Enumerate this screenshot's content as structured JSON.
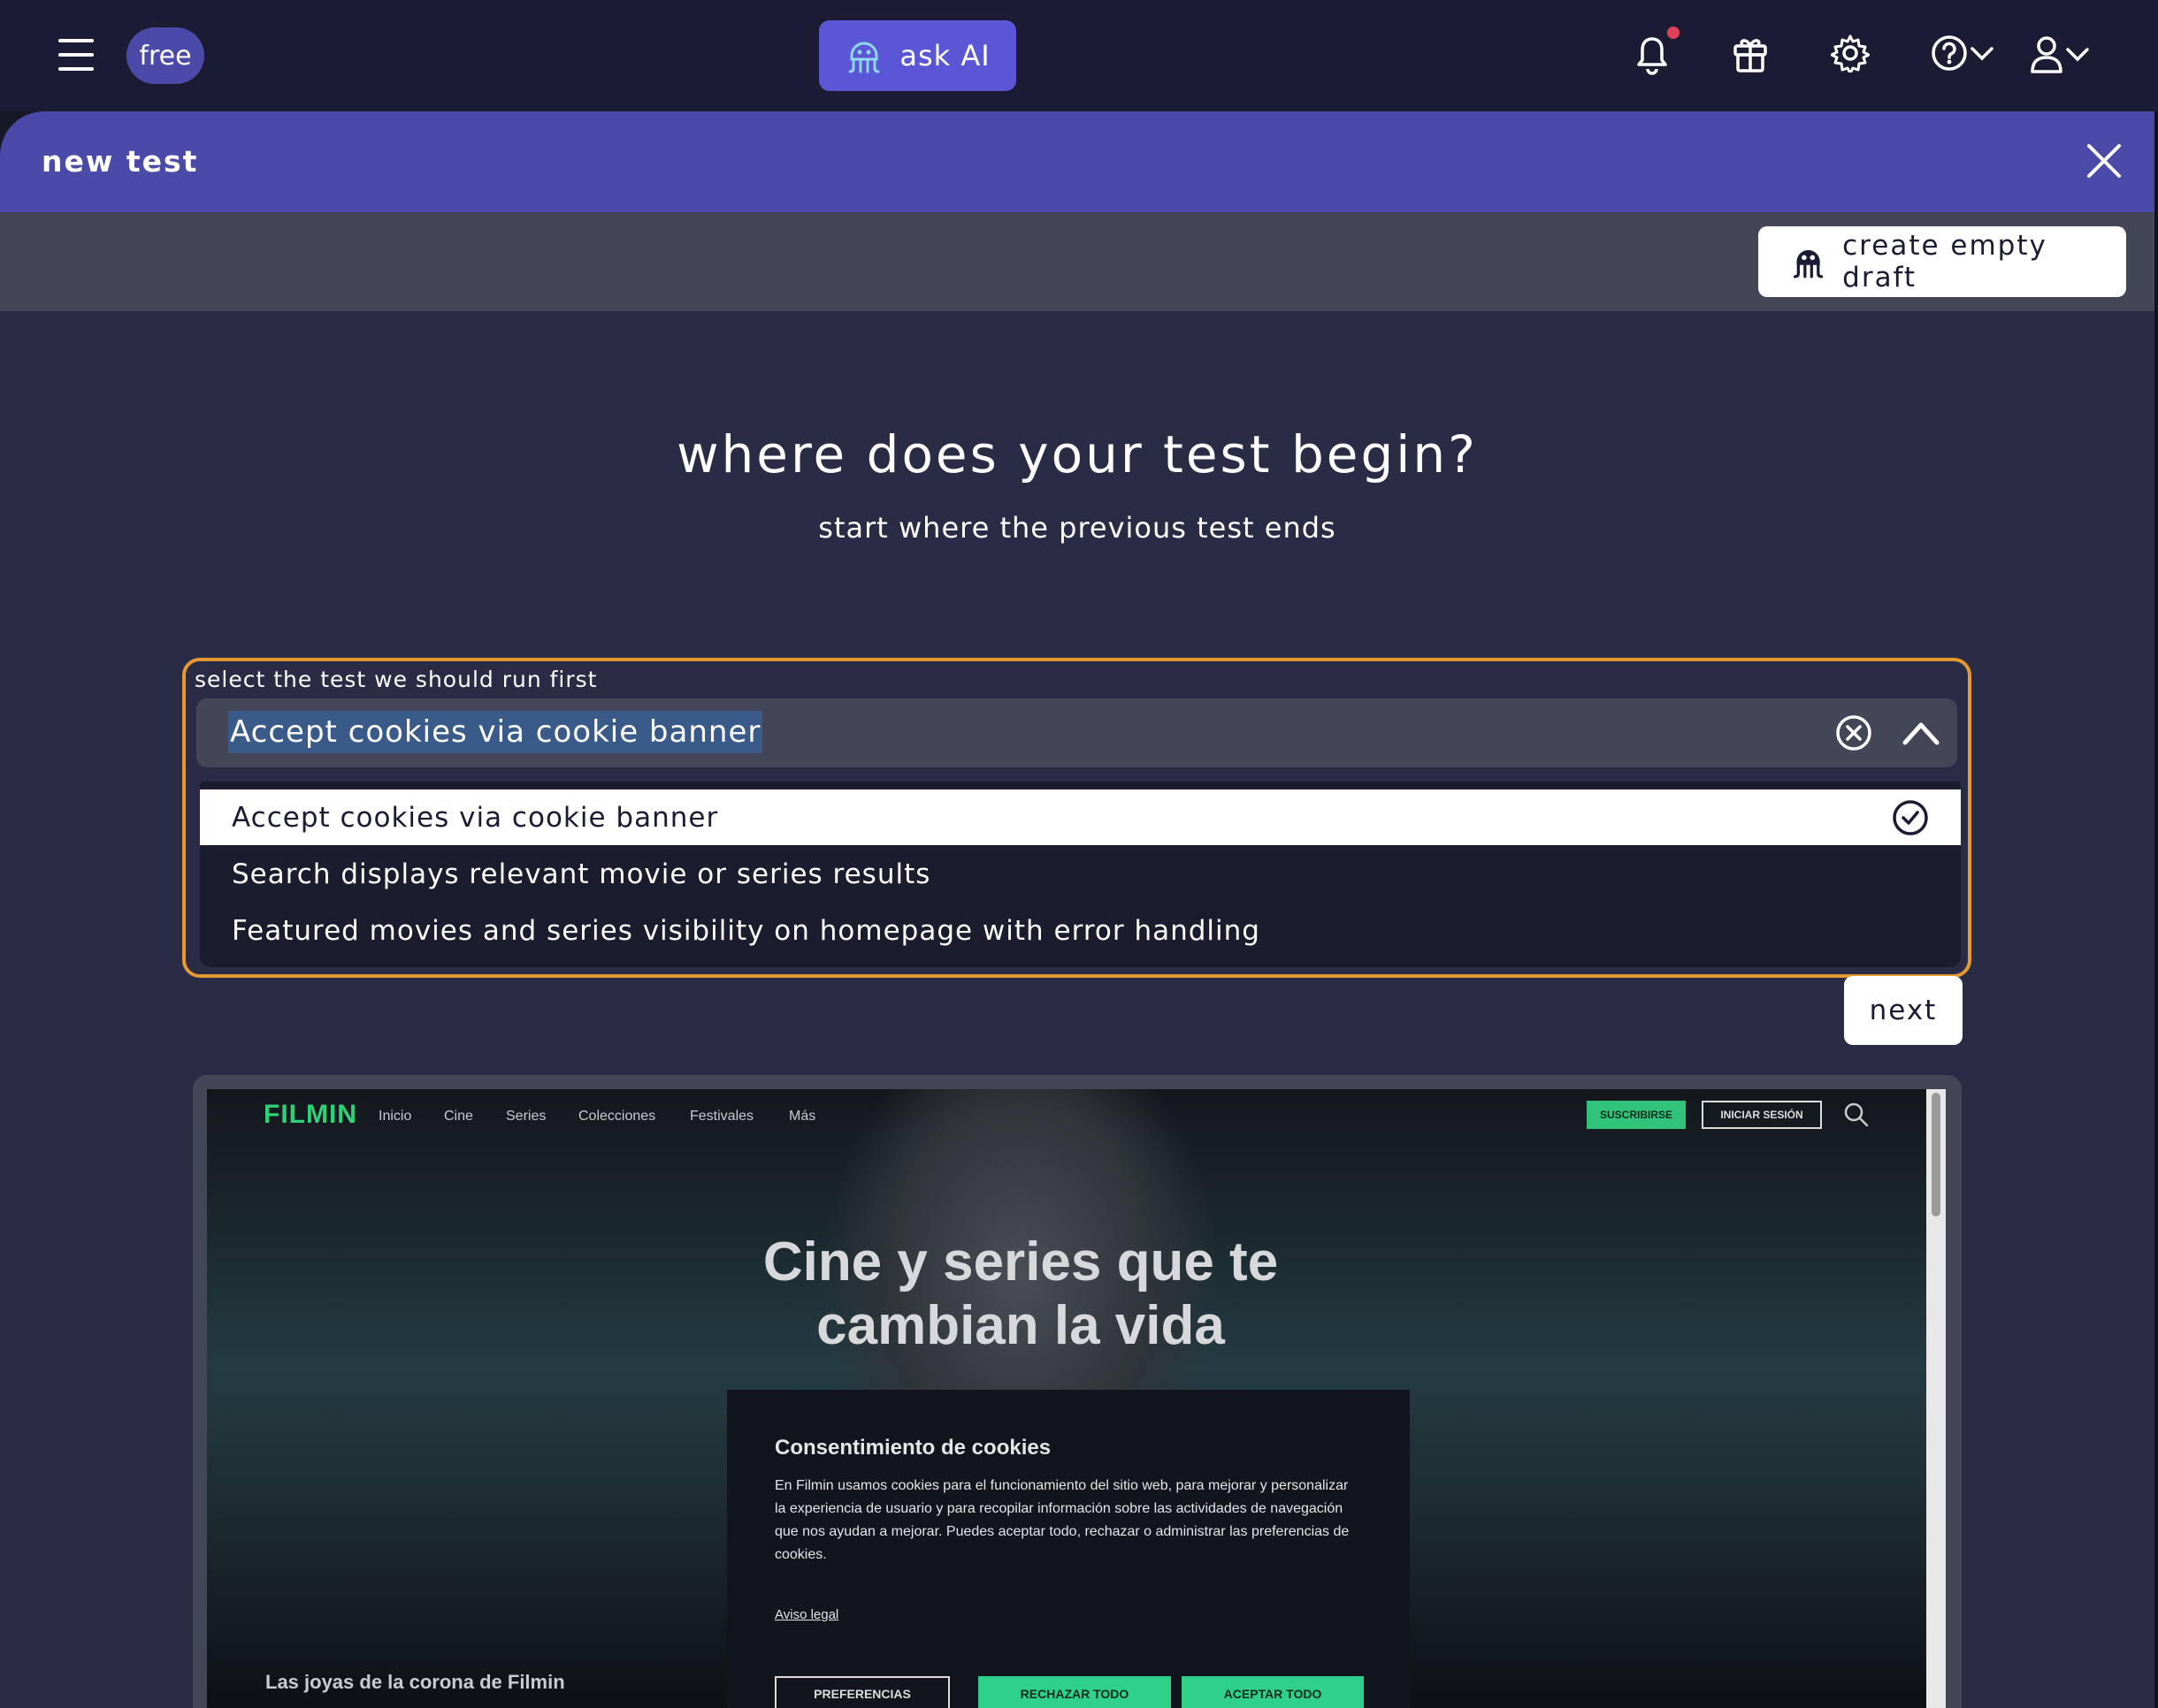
{
  "topbar": {
    "menu_icon": "hamburger-icon",
    "plan_badge": "free",
    "ask_ai_label": "ask AI",
    "icons": [
      "bell-icon",
      "gift-icon",
      "gear-icon",
      "help-icon",
      "user-icon"
    ]
  },
  "panel": {
    "title": "new test",
    "close_icon": "close-icon"
  },
  "toolbar": {
    "create_draft_label": "create empty draft"
  },
  "main": {
    "heading": "where does your test begin?",
    "subheading": "start where the previous test ends",
    "field_label": "select the test we should run first",
    "selected_value": "Accept cookies via cookie banner",
    "options": [
      {
        "label": "Accept cookies via cookie banner",
        "selected": true
      },
      {
        "label": "Search displays relevant movie or series results",
        "selected": false
      },
      {
        "label": "Featured movies and series visibility on homepage with error handling",
        "selected": false
      }
    ],
    "next_label": "next"
  },
  "preview": {
    "brand": "FILMIN",
    "nav": [
      "Inicio",
      "Cine",
      "Series",
      "Colecciones",
      "Festivales",
      "Más"
    ],
    "subscribe": "SUSCRIBIRSE",
    "login": "INICIAR SESIÓN",
    "hero": "Cine y series que te cambian la vida",
    "cookie_title": "Consentimiento de cookies",
    "cookie_body": "En Filmin usamos cookies para el funcionamiento del sitio web, para mejorar y personalizar la experiencia de usuario y para recopilar información sobre las actividades de navegación que nos ayudan a mejorar. Puedes aceptar todo, rechazar o administrar las preferencias de cookies.",
    "cookie_link": "Aviso legal",
    "btn_preferences": "PREFERENCIAS",
    "btn_reject": "RECHAZAR TODO",
    "btn_accept": "ACEPTAR TODO",
    "caption": "Las joyas de la corona de Filmin"
  },
  "colors": {
    "topbar": "#1b1c33",
    "accent": "#4b4aa8",
    "ask_ai": "#5a56d6",
    "focus_border": "#e49a31",
    "main_bg": "#2a2c45"
  }
}
